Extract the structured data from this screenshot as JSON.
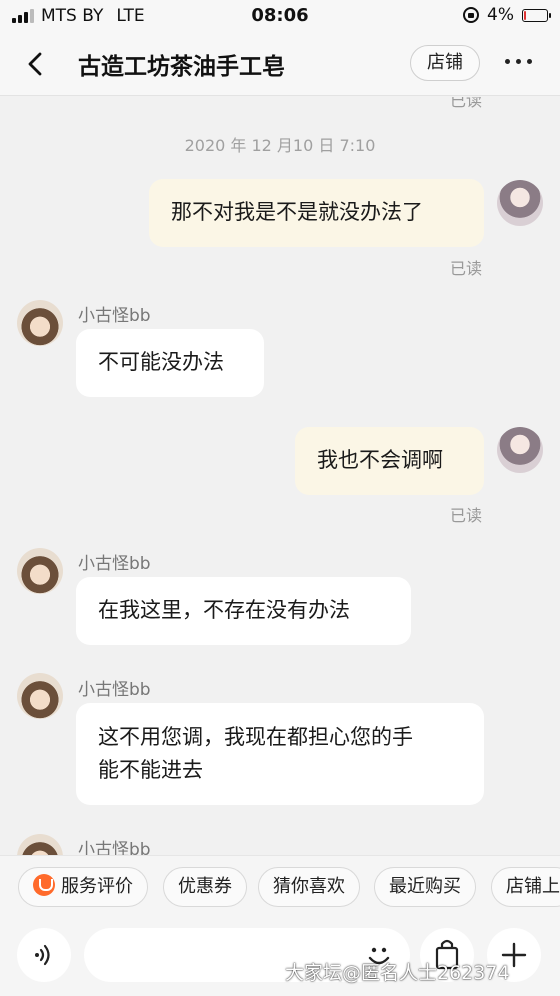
{
  "status_bar": {
    "carrier": "MTS BY",
    "network": "LTE",
    "time": "08:06",
    "battery": "4%",
    "battery_level": 0.04
  },
  "header": {
    "title": "古造工坊茶油手工皂",
    "shop_button": "店铺",
    "more_icon": "more-dots-icon"
  },
  "chat": {
    "read_label": "已读",
    "timestamp": "2020 年 12 月10 日 7:10",
    "messages": [
      {
        "from": "me",
        "text": "那不对我是不是就没办法了",
        "read": "已读"
      },
      {
        "from": "them",
        "sender": "小古怪bb",
        "text": "不可能没办法"
      },
      {
        "from": "me",
        "text": "我也不会调啊",
        "read": "已读"
      },
      {
        "from": "them",
        "sender": "小古怪bb",
        "text": "在我这里，不存在没有办法"
      },
      {
        "from": "them",
        "sender": "小古怪bb",
        "text_line1": "这不用您调，我现在都担心您的手",
        "text_line2": "能不能进去"
      },
      {
        "from": "them",
        "sender": "小古怪bb"
      }
    ]
  },
  "quick_actions": [
    "服务评价",
    "优惠券",
    "猜你喜欢",
    "最近购买",
    "店铺上"
  ],
  "input": {
    "placeholder": ""
  },
  "watermark": "大家坛@匿名人士262374",
  "colors": {
    "my_bubble": "#fbf6e6",
    "their_bubble": "#ffffff",
    "service_icon": "#ff6a2b"
  }
}
